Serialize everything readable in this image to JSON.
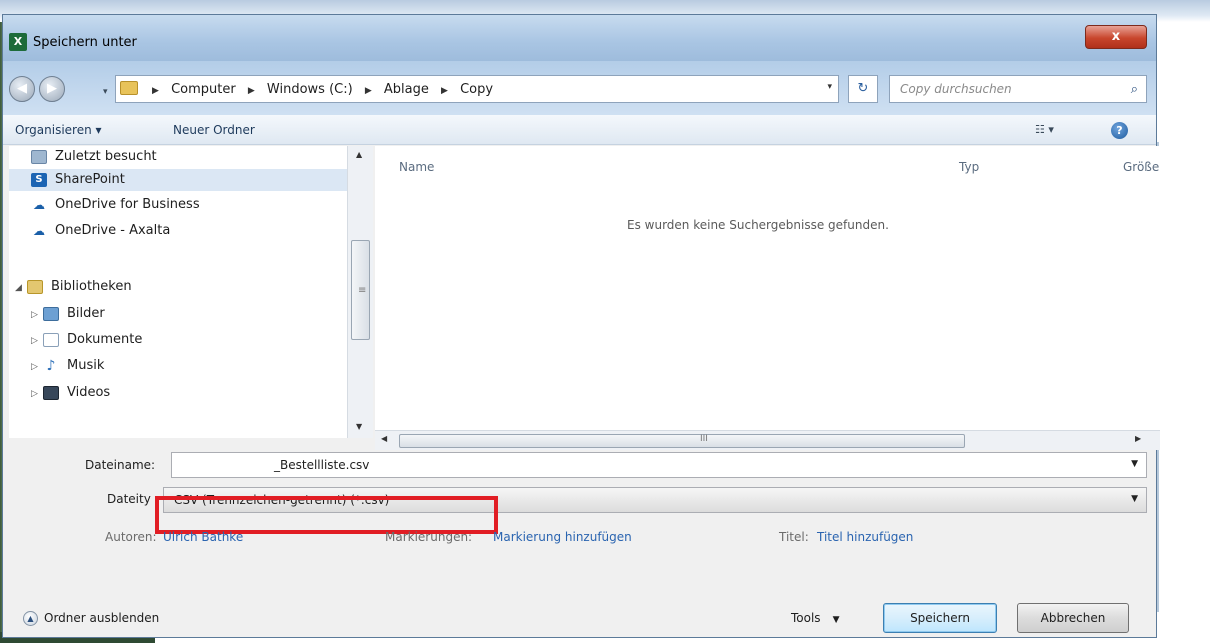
{
  "window": {
    "title": "Speichern unter",
    "app_icon": "X",
    "close_label": "x"
  },
  "navigation": {
    "breadcrumbs": [
      "Computer",
      "Windows (C:)",
      "Ablage",
      "Copy"
    ],
    "search_placeholder": "Copy durchsuchen"
  },
  "toolbar": {
    "organize_label": "Organisieren ▾",
    "new_folder_label": "Neuer Ordner",
    "help_label": "?"
  },
  "sidebar": {
    "items": [
      {
        "label": "Zuletzt besucht",
        "icon": "recent-places-icon"
      },
      {
        "label": "SharePoint",
        "icon": "sharepoint-icon",
        "selected": true
      },
      {
        "label": "OneDrive for Business",
        "icon": "onedrive-icon"
      },
      {
        "label": "OneDrive - Axalta",
        "icon": "onedrive-icon"
      },
      {
        "label": "Bibliotheken",
        "icon": "libraries-icon",
        "expanded": true
      },
      {
        "label": "Bilder",
        "icon": "pictures-icon"
      },
      {
        "label": "Dokumente",
        "icon": "documents-icon"
      },
      {
        "label": "Musik",
        "icon": "music-icon"
      },
      {
        "label": "Videos",
        "icon": "videos-icon"
      }
    ]
  },
  "file_list": {
    "columns": [
      "Name",
      "Typ",
      "Größe"
    ],
    "empty_message": "Es wurden keine Suchergebnisse gefunden."
  },
  "form": {
    "filename_label": "Dateiname:",
    "filename_value": "_Bestellliste.csv",
    "filetype_label": "Dateity",
    "filetype_value": "CSV (Trennzeichen-getrennt) (*.csv)",
    "authors_label": "Autoren:",
    "authors_value": "Ulrich Bathke",
    "tags_label": "Markierungen:",
    "tags_value": "Markierung hinzufügen",
    "title_label": "Titel:",
    "title_value": "Titel hinzufügen"
  },
  "footer": {
    "hide_folders_label": "Ordner ausblenden",
    "tools_label": "Tools",
    "save_label": "Speichern",
    "cancel_label": "Abbrechen"
  },
  "colors": {
    "highlight_box": "#e11d24",
    "link_blue": "#2a64b0",
    "close_button": "#c8462d"
  }
}
